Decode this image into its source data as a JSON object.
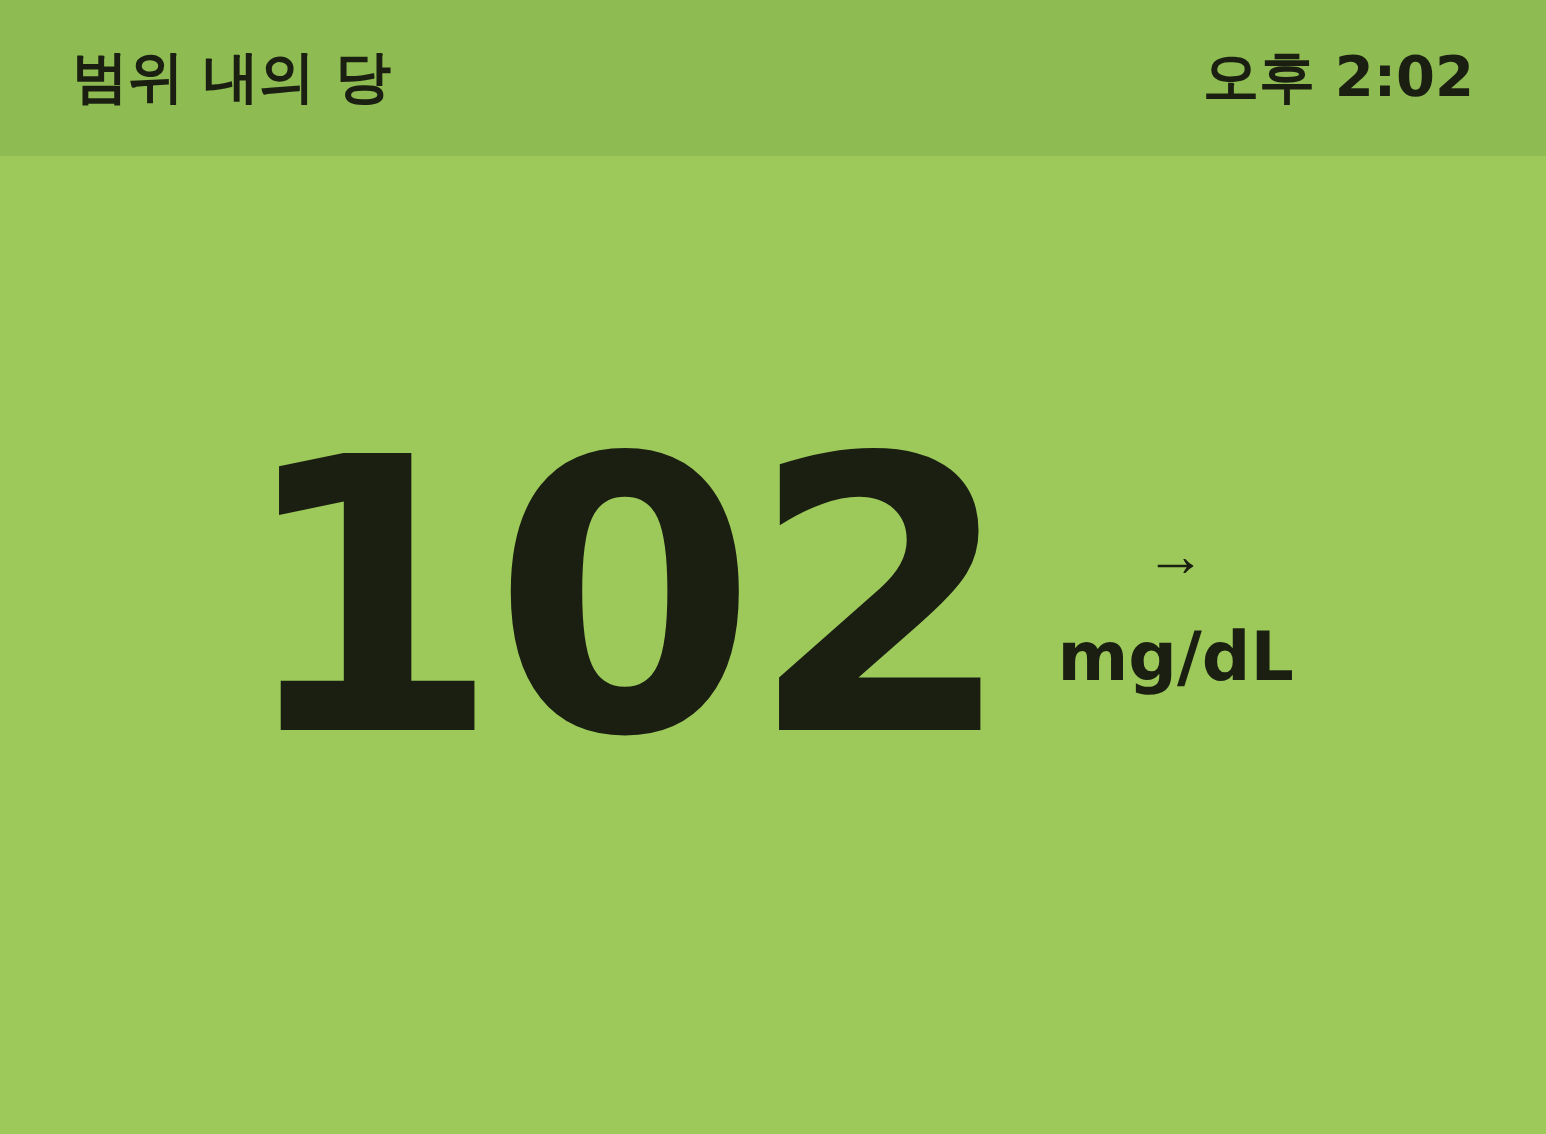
{
  "header": {
    "title": "범위 내의 당",
    "time": "오후 2:02"
  },
  "reading": {
    "value": "102",
    "trend_arrow": "→",
    "unit": "mg/dL"
  }
}
